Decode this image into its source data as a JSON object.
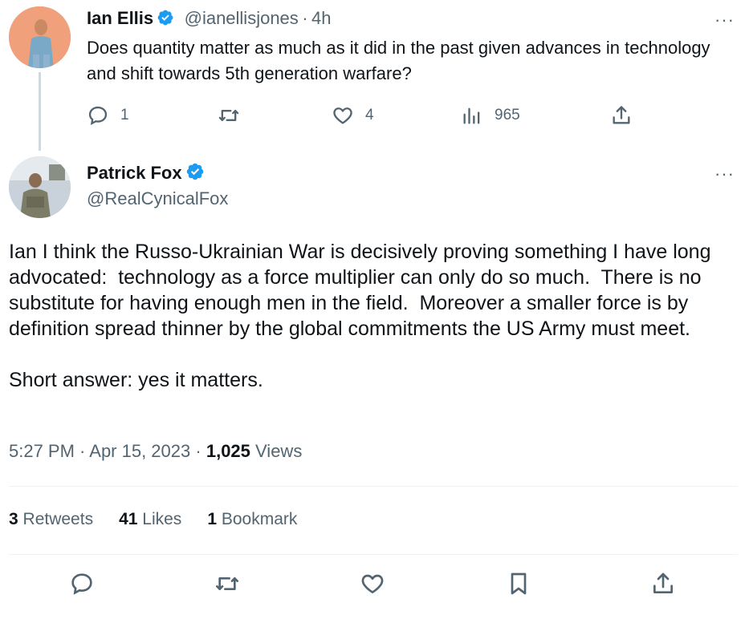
{
  "reply_tweet": {
    "name": "Ian Ellis",
    "handle": "@ianellisjones",
    "separator": "·",
    "time": "4h",
    "text": "Does quantity matter as much as it did in the past given advances in technology and shift towards 5th generation warfare?",
    "more": "···",
    "actions": {
      "replies": "1",
      "retweets": "",
      "likes": "4",
      "views": "965"
    }
  },
  "main_tweet": {
    "name": "Patrick Fox",
    "handle": "@RealCynicalFox",
    "more": "···",
    "text": "Ian I think the Russo-Ukrainian War is decisively proving something I have long advocated:  technology as a force multiplier can only do so much.  There is no substitute for having enough men in the field.  Moreover a smaller force is by definition spread thinner by the global commitments the US Army must meet.\n\nShort answer: yes it matters.",
    "timestamp": "5:27 PM · Apr 15, 2023",
    "meta_sep": "·",
    "views_count": "1,025",
    "views_label": "Views",
    "stats": {
      "retweets_count": "3",
      "retweets_label": "Retweets",
      "likes_count": "41",
      "likes_label": "Likes",
      "bookmarks_count": "1",
      "bookmarks_label": "Bookmark"
    }
  },
  "colors": {
    "text": "#0f1419",
    "secondary": "#536471",
    "verified": "#1d9bf0",
    "divider": "#eff3f4"
  }
}
